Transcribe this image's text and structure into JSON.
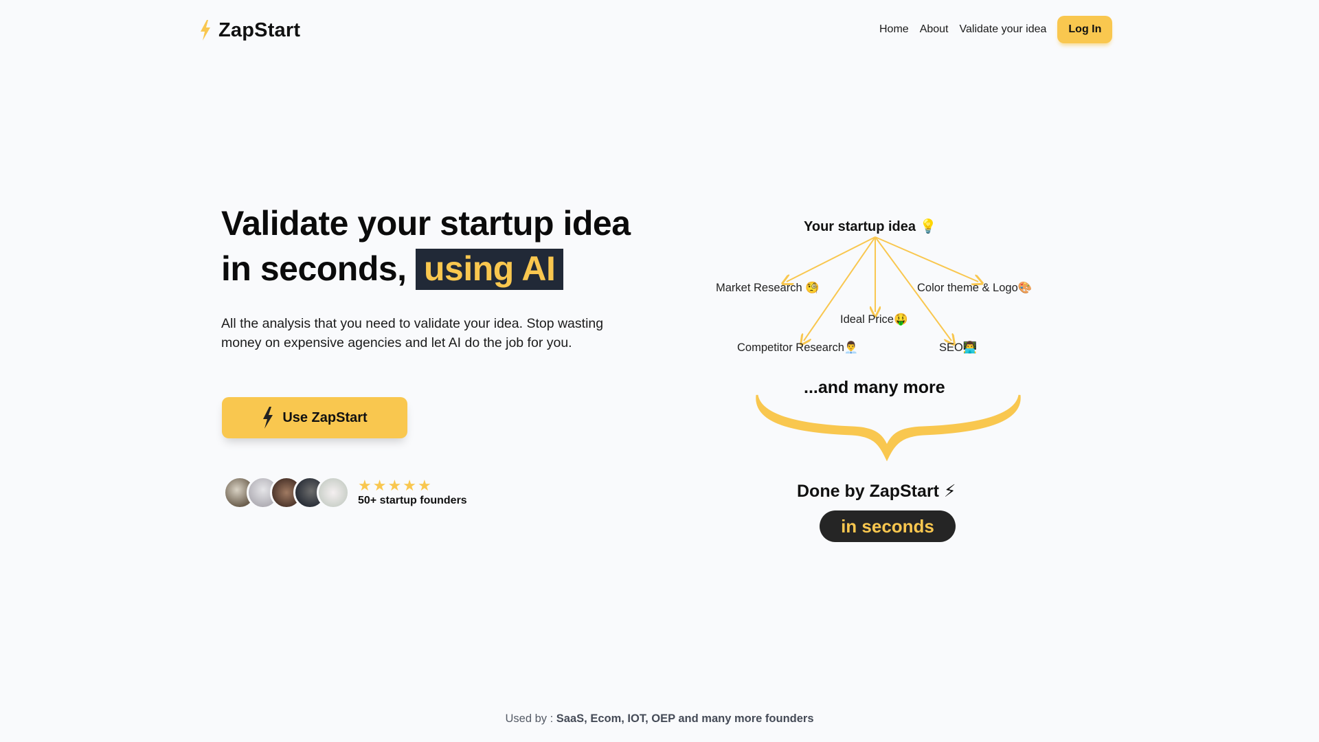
{
  "header": {
    "brand": "ZapStart",
    "logo_icon": "lightning-bolt-icon",
    "nav": [
      {
        "label": "Home"
      },
      {
        "label": "About"
      },
      {
        "label": "Validate your idea"
      }
    ],
    "login_label": "Log In"
  },
  "hero": {
    "headline_line1": "Validate your startup idea",
    "headline_line2_prefix": "in seconds,",
    "headline_highlight": "using AI",
    "subtitle": "All the analysis that you need to validate your idea. Stop wasting money on expensive agencies and let AI do the job for you.",
    "cta_label": "Use ZapStart",
    "cta_icon": "lightning-bolt-icon",
    "rating_stars": 5,
    "social_proof": "50+ startup founders",
    "avatars_count": 5
  },
  "diagram": {
    "root": "Your startup idea 💡",
    "nodes": [
      {
        "label": "Market Research 🧐"
      },
      {
        "label": "Color theme & Logo🎨"
      },
      {
        "label": "Ideal Price🤑"
      },
      {
        "label": "Competitor Research👨‍💼"
      },
      {
        "label": "SEO👨‍💻"
      }
    ],
    "more": "...and many more",
    "done_by": "Done by ZapStart ⚡",
    "pill": "in seconds"
  },
  "footer": {
    "prefix": "Used by : ",
    "text": "SaaS, Ecom, IOT, OEP and many more founders"
  },
  "colors": {
    "accent": "#f9c74f",
    "dark": "#212937",
    "pill_bg": "#252525",
    "background": "#f9fafc"
  }
}
